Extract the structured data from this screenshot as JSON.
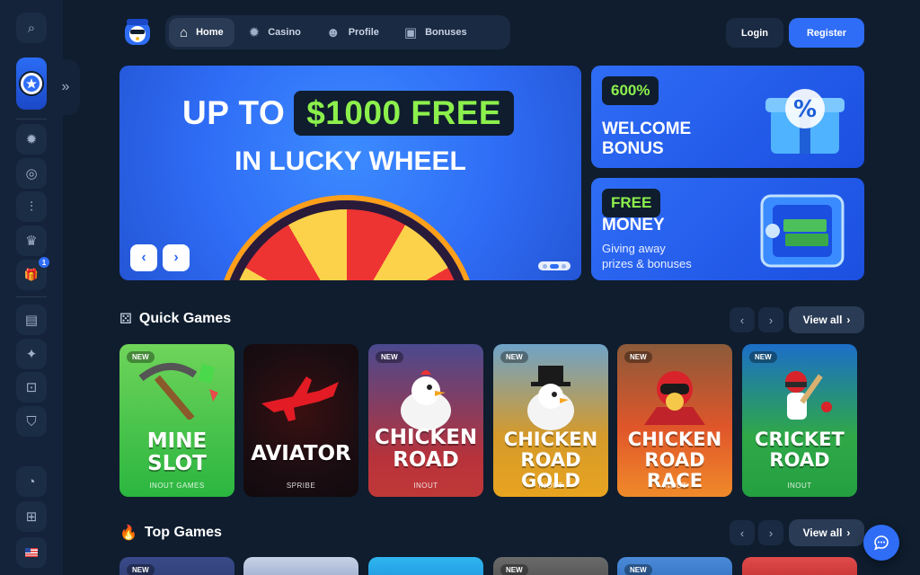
{
  "colors": {
    "background": "#0f1d2e",
    "accent": "#2f6df6",
    "green": "#8cf04c"
  },
  "sidebar": {
    "items": [
      {
        "name": "search-icon",
        "glyph": "⌕"
      },
      {
        "name": "casino-chip-icon",
        "glyph": "✹"
      },
      {
        "name": "globe-icon",
        "glyph": "◎"
      },
      {
        "name": "chart-icon",
        "glyph": "⫶"
      },
      {
        "name": "crown-icon",
        "glyph": "♛"
      },
      {
        "name": "gift-icon",
        "glyph": "🎁",
        "badge": "1"
      },
      {
        "name": "book-icon",
        "glyph": "▤"
      },
      {
        "name": "gamepad-icon",
        "glyph": "✦"
      },
      {
        "name": "lock-icon",
        "glyph": "⊡"
      },
      {
        "name": "shield-icon",
        "glyph": "⛉"
      },
      {
        "name": "chat-bubbles-icon",
        "glyph": "◔"
      },
      {
        "name": "windows-icon",
        "glyph": "⊞"
      },
      {
        "name": "us-flag-icon",
        "glyph": "▭"
      }
    ]
  },
  "nav": {
    "items": [
      {
        "label": "Home",
        "icon": "⌂"
      },
      {
        "label": "Casino",
        "icon": "✹"
      },
      {
        "label": "Profile",
        "icon": "☻"
      },
      {
        "label": "Bonuses",
        "icon": "▣"
      }
    ],
    "login": "Login",
    "register": "Register"
  },
  "hero": {
    "line1_prefix": "UP TO",
    "line1_amount": "$1000 FREE",
    "line2": "IN LUCKY WHEEL",
    "prev": "‹",
    "next": "›"
  },
  "promos": [
    {
      "badge": "600%",
      "title_line1": "WELCOME",
      "title_line2": "BONUS"
    },
    {
      "badge": "FREE",
      "title_line1": "MONEY",
      "sub_line1": "Giving away",
      "sub_line2": "prizes & bonuses"
    }
  ],
  "quick_games": {
    "title": "Quick Games",
    "view_all": "View all",
    "games": [
      {
        "title_l1": "MINE",
        "title_l2": "SLOT",
        "provider": "INOUT GAMES",
        "new": "NEW"
      },
      {
        "title_l1": "AVIATOR",
        "title_l2": "",
        "provider": "SPRIBE",
        "new": ""
      },
      {
        "title_l1": "CHICKEN",
        "title_l2": "ROAD",
        "provider": "INOUT",
        "new": "NEW"
      },
      {
        "title_l1": "CHICKEN",
        "title_l2": "ROAD GOLD",
        "provider": "INOUT",
        "new": "NEW"
      },
      {
        "title_l1": "CHICKEN",
        "title_l2": "ROAD RACE",
        "provider": "INOUT",
        "new": "NEW"
      },
      {
        "title_l1": "CRICKET",
        "title_l2": "ROAD",
        "provider": "INOUT",
        "new": "NEW"
      }
    ]
  },
  "top_games": {
    "title": "Top Games",
    "view_all": "View all",
    "new_labels": [
      "NEW",
      "",
      "",
      "NEW",
      "NEW",
      ""
    ]
  }
}
